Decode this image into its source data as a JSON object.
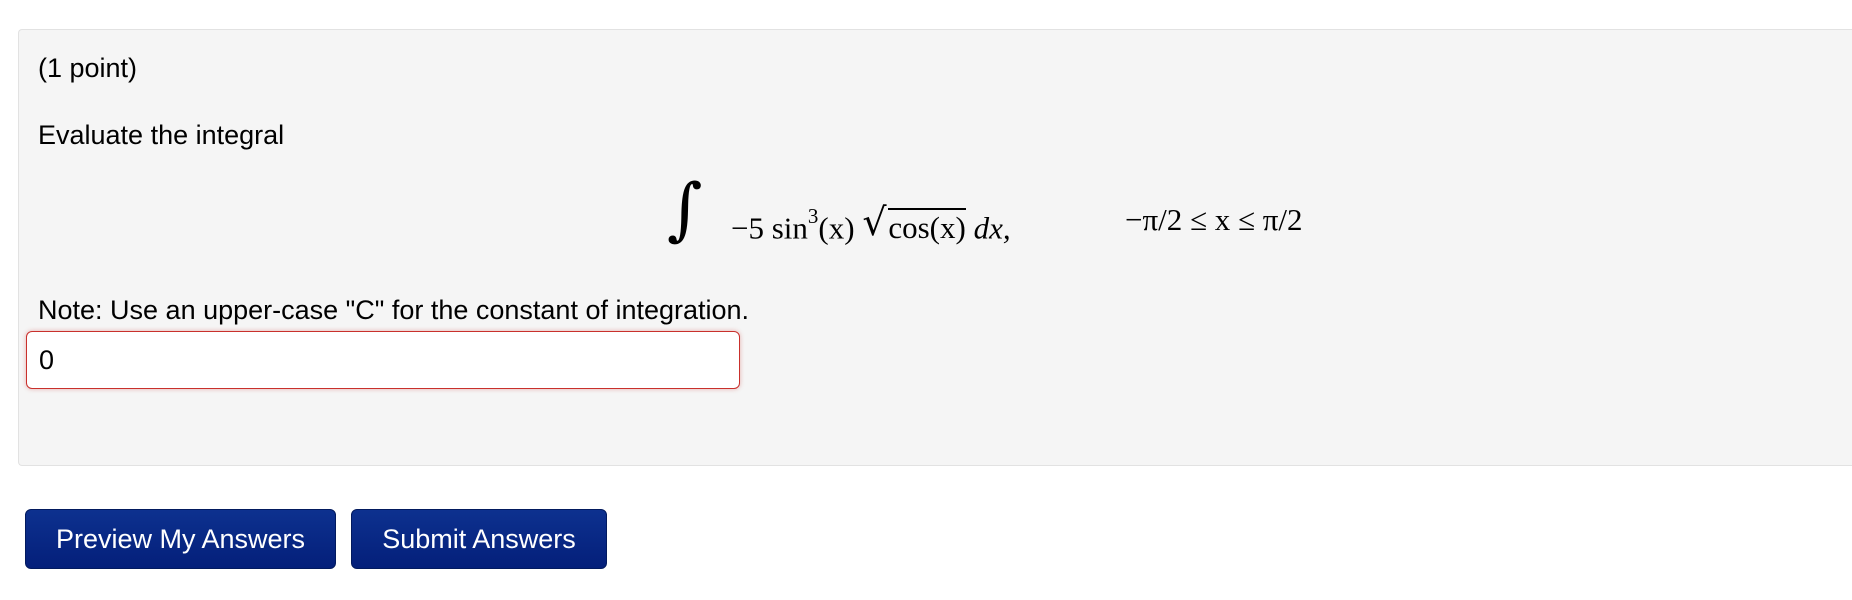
{
  "problem": {
    "points_label": "(1 point)",
    "prompt": "Evaluate the integral",
    "integral": {
      "sign": "∫",
      "coefficient": "−5",
      "function": "sin",
      "power": "3",
      "argument": "(x)",
      "sqrt_body": "cos(x)",
      "differential": "dx,"
    },
    "domain": "−π/2 ≤ x ≤ π/2",
    "note": "Note: Use an upper-case \"C\" for the constant of integration.",
    "answer_value": "0"
  },
  "buttons": {
    "preview": "Preview My Answers",
    "submit": "Submit Answers"
  },
  "colors": {
    "panel_bg": "#f5f5f5",
    "button_bg": "#0a2a8c",
    "error_border": "#c9302c"
  }
}
